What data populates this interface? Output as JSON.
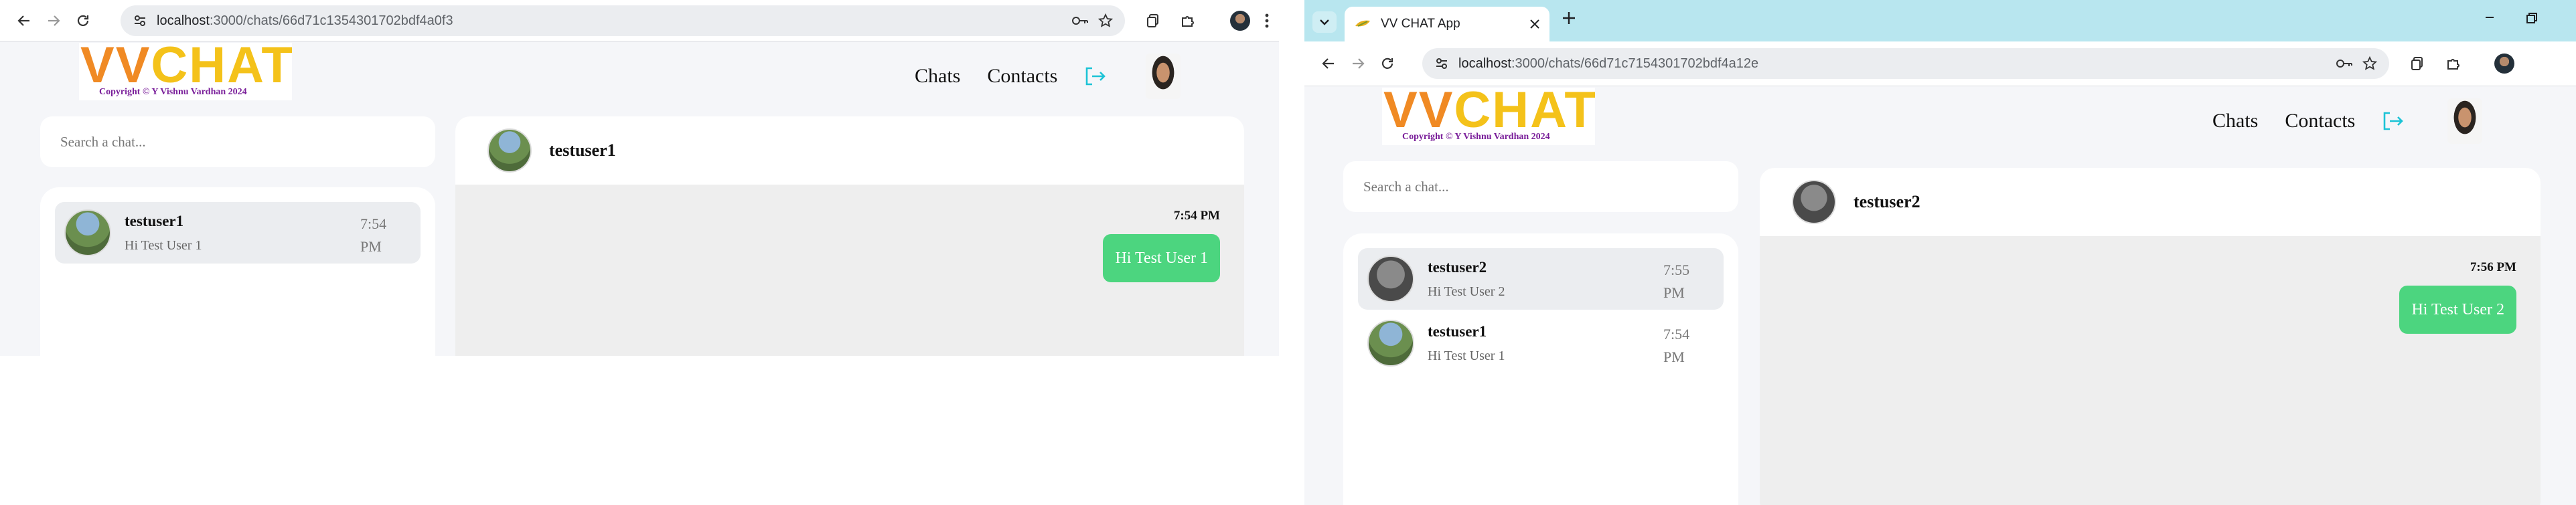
{
  "left": {
    "url_host": "localhost",
    "url_path": ":3000/chats/66d71c1354301702bdf4a0f3",
    "app": {
      "logo_main": "CHAT",
      "logo_v": "VV",
      "copyright": "Copyright © Y Vishnu Vardhan 2024",
      "nav_chats": "Chats",
      "nav_contacts": "Contacts"
    },
    "search_placeholder": "Search a chat...",
    "chats": [
      {
        "name": "testuser1",
        "message": "Hi Test User 1",
        "time": "7:54 PM"
      }
    ],
    "conversation": {
      "name": "testuser1",
      "msg_time": "7:54 PM",
      "msg_text": "Hi Test User 1"
    }
  },
  "right": {
    "tab_title": "VV CHAT App",
    "url_host": "localhost",
    "url_path": ":3000/chats/66d71c7154301702bdf4a12e",
    "app": {
      "logo_main": "CHAT",
      "logo_v": "VV",
      "copyright": "Copyright © Y Vishnu Vardhan 2024",
      "nav_chats": "Chats",
      "nav_contacts": "Contacts"
    },
    "search_placeholder": "Search a chat...",
    "chats": [
      {
        "name": "testuser2",
        "message": "Hi Test User 2",
        "time": "7:55 PM"
      },
      {
        "name": "testuser1",
        "message": "Hi Test User 1",
        "time": "7:54 PM"
      }
    ],
    "conversation": {
      "name": "testuser2",
      "msg_time": "7:56 PM",
      "msg_text": "Hi Test User 2"
    }
  },
  "colors": {
    "accent_green": "#4cd57f",
    "logout_cyan": "#1cc3d6",
    "logo_orange": "#f08a24",
    "logo_yellow": "#f4c21a"
  }
}
